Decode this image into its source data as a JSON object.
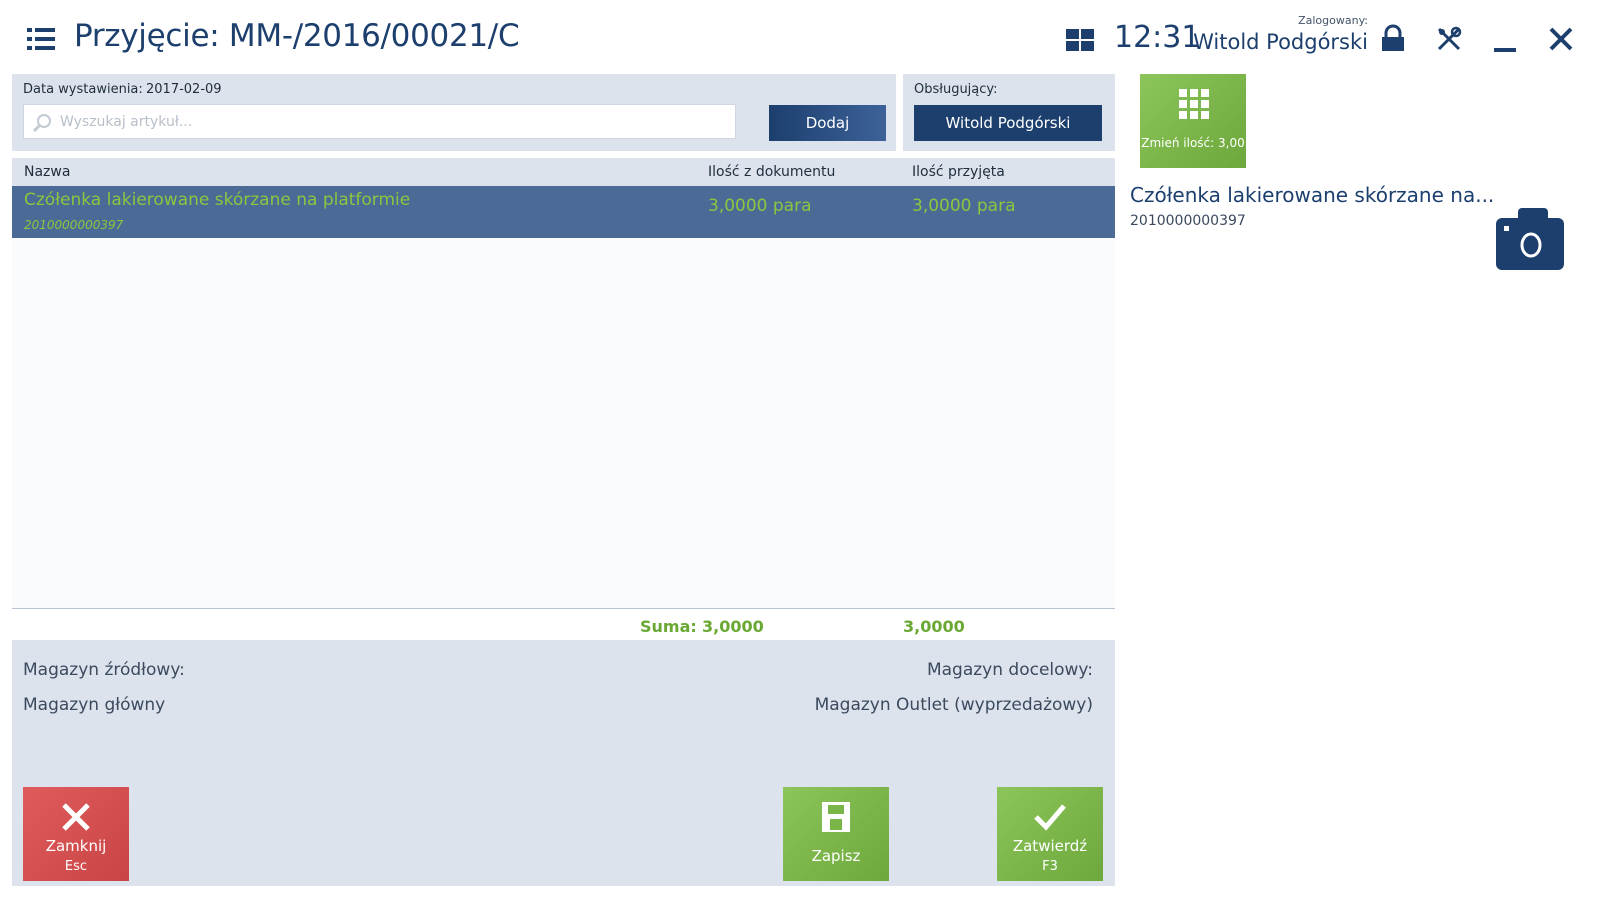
{
  "header": {
    "title": "Przyjęcie: MM-/2016/00021/C",
    "time": "12:31",
    "logged_label": "Zalogowany:",
    "user": "Witold Podgórski"
  },
  "document": {
    "date_label": "Data wystawienia:",
    "date_value": "2017-02-09",
    "search_placeholder": "Wyszukaj artykuł...",
    "add_label": "Dodaj",
    "operator_label": "Obsługujący:",
    "operator_value": "Witold Podgórski"
  },
  "table": {
    "columns": [
      "Nazwa",
      "Ilość z dokumentu",
      "Ilość przyjęta"
    ],
    "rows": [
      {
        "name": "Czółenka lakierowane skórzane na platformie",
        "code": "2010000000397",
        "qty_doc": "3,0000 para",
        "qty_received": "3,0000 para"
      }
    ],
    "sum_label": "Suma:",
    "sum_doc": "3,0000",
    "sum_received": "3,0000"
  },
  "warehouses": {
    "source_label": "Magazyn źródłowy:",
    "source_value": "Magazyn główny",
    "target_label": "Magazyn docelowy:",
    "target_value": "Magazyn Outlet (wyprzedażowy)"
  },
  "actions": {
    "close_label": "Zamknij",
    "close_key": "Esc",
    "save_label": "Zapisz",
    "confirm_label": "Zatwierdź",
    "confirm_key": "F3"
  },
  "detail": {
    "change_qty_label": "Zmień ilość: 3,00",
    "name": "Czółenka lakierowane skórzane na...",
    "code": "2010000000397"
  },
  "colors": {
    "primary": "#1c3f6e",
    "panel": "#dde3ec",
    "selected_row": "#4c6a96",
    "accent_green": "#8cc63f",
    "danger": "#d14f4f"
  }
}
